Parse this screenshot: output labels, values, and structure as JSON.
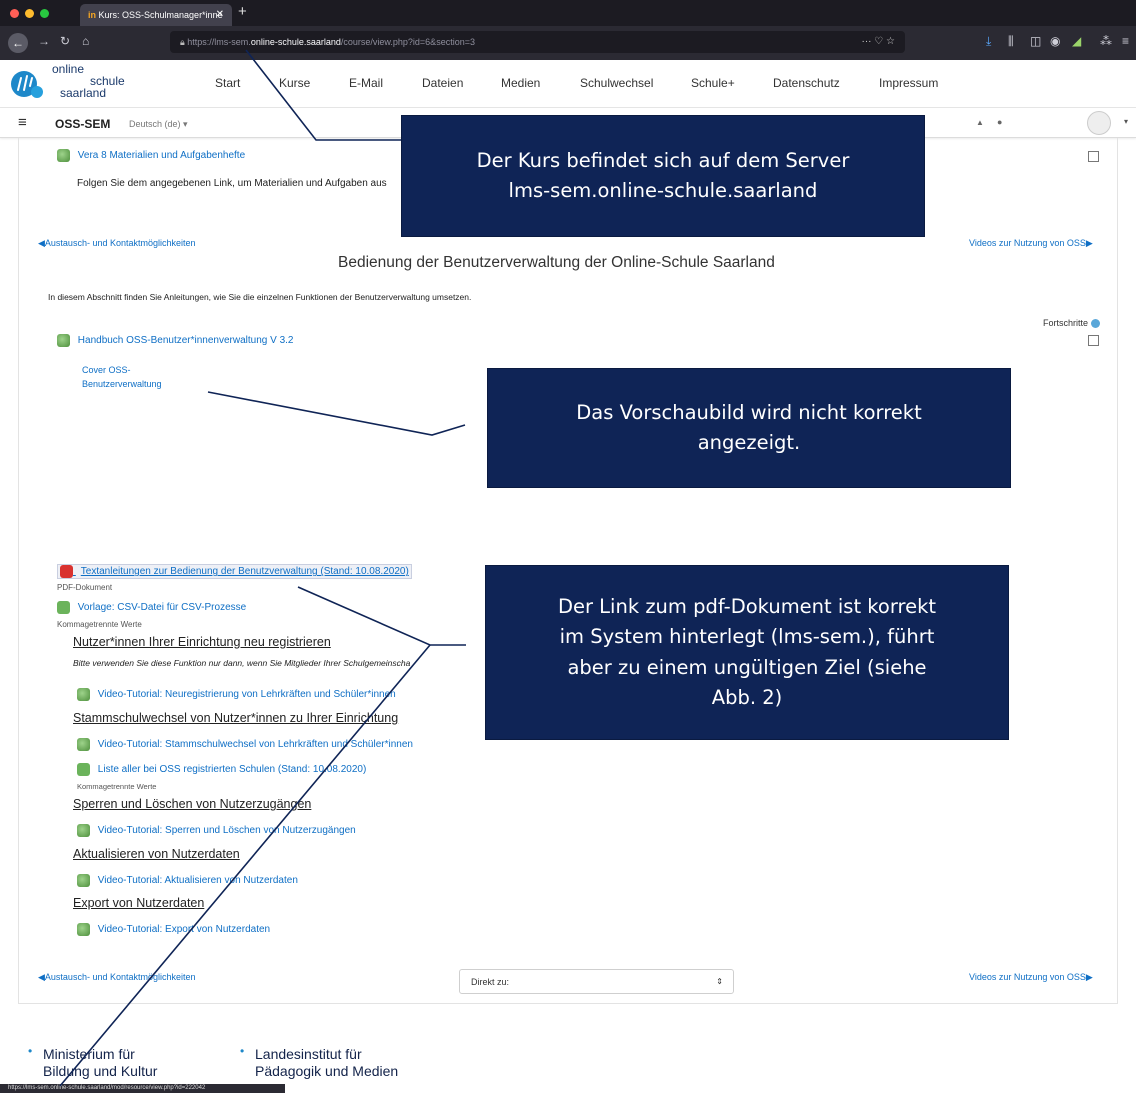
{
  "browser": {
    "tab_title": "Kurs: OSS-Schulmanager*inne",
    "tab_close": "✕",
    "new_tab": "+",
    "url_prefix": "https://lms-sem.",
    "url_domain": "online-schule.saarland",
    "url_path": "/course/view.php?id=6&section=3",
    "url_actions": "···  ♡  ☆",
    "status_url": "https://lms-sem.online-schule.saarland/mod/resource/view.php?id=222042"
  },
  "site": {
    "logo_line1": "online",
    "logo_line2": "schule",
    "logo_line3": "saarland",
    "nav": [
      "Start",
      "Kurse",
      "E-Mail",
      "Dateien",
      "Medien",
      "Schulwechsel",
      "Schule+",
      "Datenschutz",
      "Impressum"
    ],
    "colors": {
      "link": "#0f6fc5",
      "callout": "#0f2456",
      "logo_blue": "#1e88c9"
    }
  },
  "usernav": {
    "menu_icon": "≡",
    "course_short": "OSS-SEM",
    "language": "Deutsch (de)",
    "language_caret": "▾",
    "bell_icon": "▲",
    "chat_icon": "●",
    "user_caret": "▾"
  },
  "content": {
    "top_resource": "Vera 8 Materialien und Aufgabenhefte",
    "top_desc": "Folgen Sie dem angegebenen Link, um Materialien und Aufgaben aus",
    "prev_section": "◀Austausch- und Kontaktmöglichkeiten",
    "next_section": "Videos zur Nutzung von OSS▶",
    "section_title": "Bedienung der Benutzerverwaltung der Online-Schule Saarland",
    "section_summary": "In diesem Abschnitt finden Sie Anleitungen, wie Sie die einzelnen Funktionen der Benutzerverwaltung umsetzen.",
    "progress_label": "Fortschritte",
    "handbook": "Handbuch OSS-Benutzer*innenverwaltung V 3.2",
    "cover_alt_1": "Cover OSS-",
    "cover_alt_2": "Benutzerverwaltung",
    "pdf_link": "Textanleitungen zur Bedienung der Benutzverwaltung (Stand: 10.08.2020)",
    "pdf_type": "PDF-Dokument",
    "csv_link": "Vorlage: CSV-Datei für CSV-Prozesse",
    "csv_type": "Kommagetrennte Werte",
    "h_register": "Nutzer*innen Ihrer Einrichtung neu registrieren",
    "register_note": "Bitte verwenden Sie diese Funktion nur dann, wenn Sie Mitglieder Ihrer Schulgemeinscha",
    "video_register": "Video-Tutorial: Neuregistrierung von Lehrkräften und Schüler*innen",
    "h_switch": "Stammschulwechsel von Nutzer*innen zu Ihrer Einrichtung",
    "video_switch": "Video-Tutorial: Stammschulwechsel von Lehrkräften und Schüler*innen",
    "schools_list": "Liste aller bei OSS registrierten Schulen (Stand: 10.08.2020)",
    "schools_type": "Kommagetrennte Werte",
    "h_lock": "Sperren und Löschen von Nutzerzugängen",
    "video_lock": "Video-Tutorial: Sperren und Löschen von Nutzerzugängen",
    "h_update": "Aktualisieren von Nutzerdaten",
    "video_update": "Video-Tutorial: Aktualisieren von Nutzerdaten",
    "h_export": "Export von Nutzerdaten",
    "video_export": "Video-Tutorial: Export von Nutzerdaten",
    "jump_to": "Direkt zu:",
    "jump_caret": "⇕"
  },
  "callouts": {
    "server": [
      "Der Kurs befindet sich auf dem Server",
      "lms-sem.online-schule.saarland"
    ],
    "preview": [
      "Das Vorschaubild wird nicht korrekt",
      "angezeigt."
    ],
    "pdf": [
      "Der Link zum pdf-Dokument ist korrekt",
      "im System hinterlegt (lms-sem.), führt",
      "aber zu einem ungültigen Ziel (siehe",
      "Abb. 2)"
    ]
  },
  "footer": {
    "ministry_1": "Ministerium für",
    "ministry_2": "Bildung und Kultur",
    "institute_1": "Landesinstitut für",
    "institute_2": "Pädagogik und Medien"
  }
}
